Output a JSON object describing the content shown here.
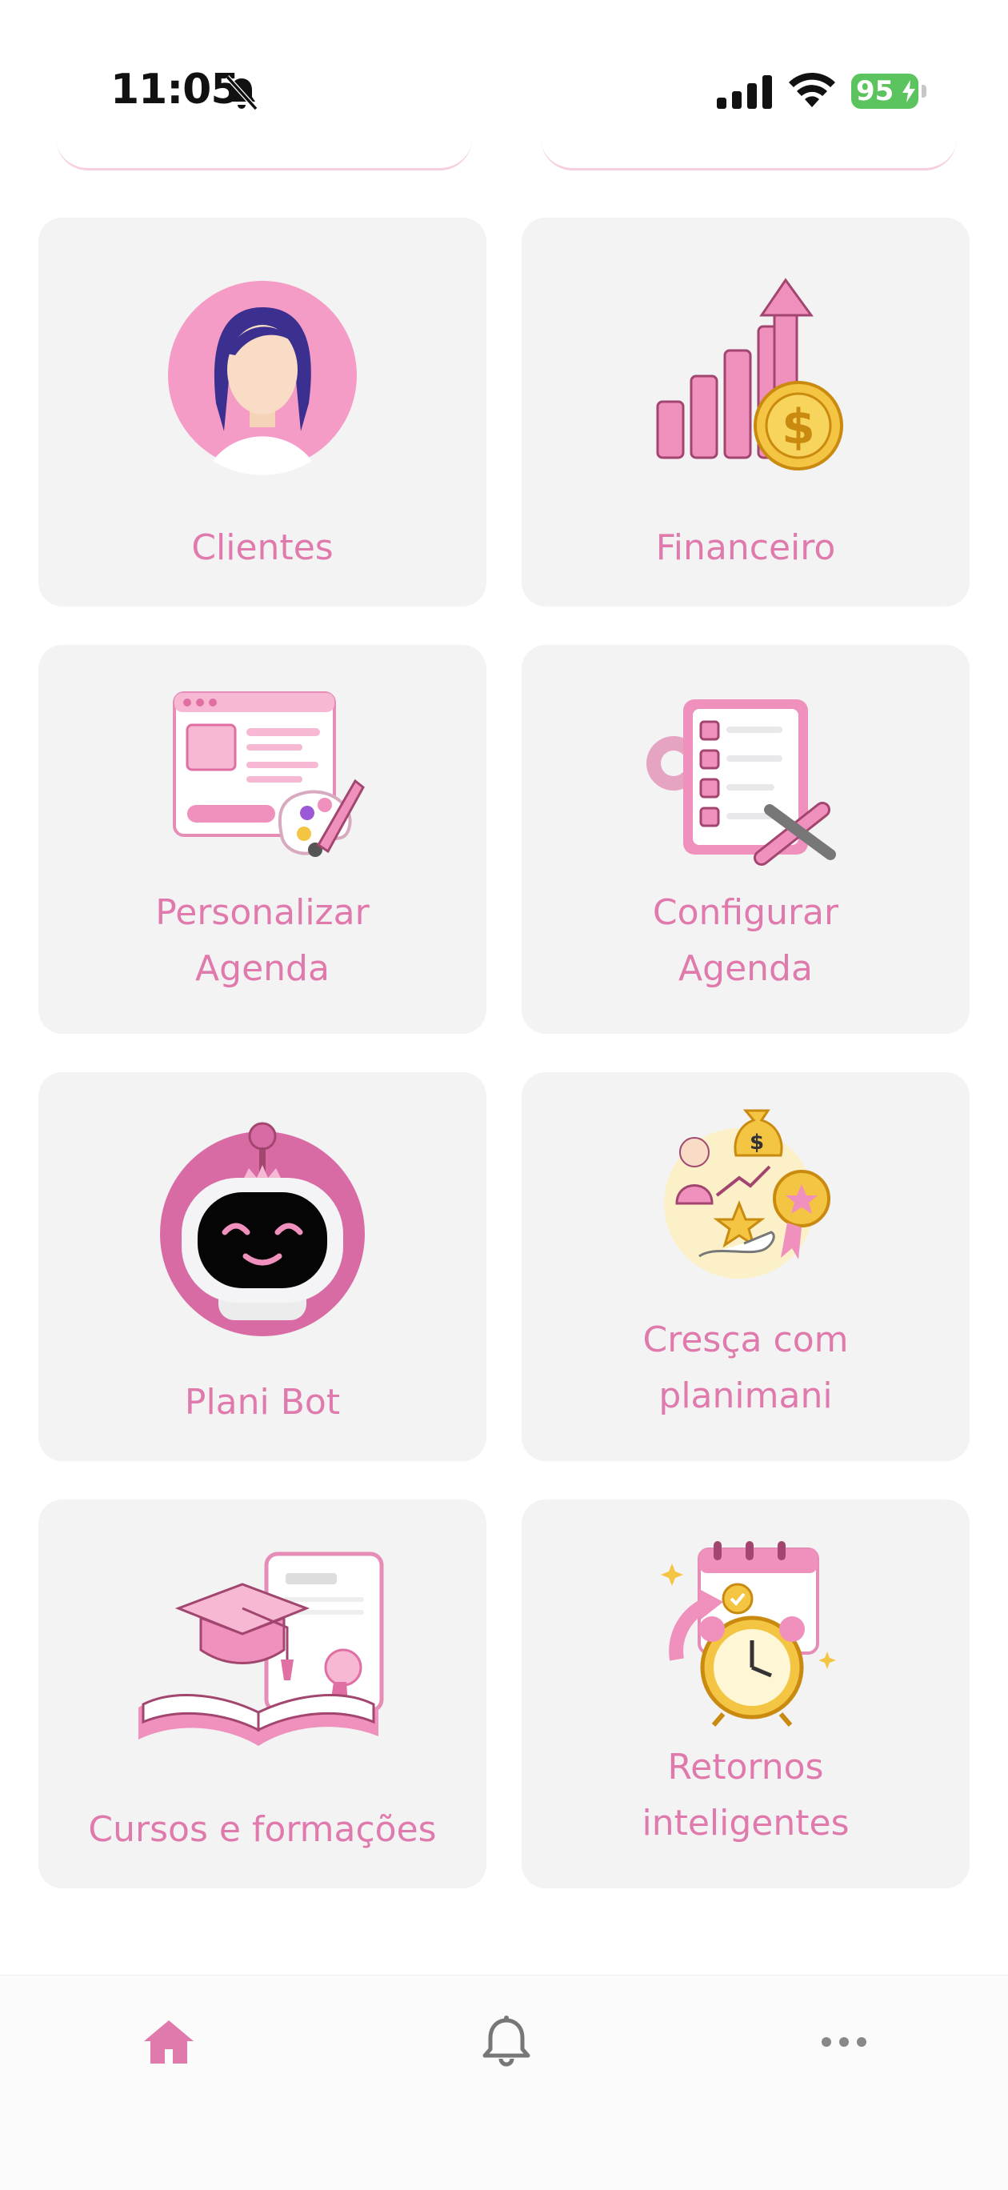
{
  "status_bar": {
    "time": "11:05",
    "battery": "95"
  },
  "colors": {
    "accent": "#e07aac",
    "card_bg": "#f3f3f4",
    "battery_green": "#5cc45f"
  },
  "cards": [
    {
      "label": "Clientes",
      "icon": "client-avatar-icon"
    },
    {
      "label": "Financeiro",
      "icon": "growth-chart-icon"
    },
    {
      "label": "Personalizar\nAgenda",
      "icon": "customize-palette-icon"
    },
    {
      "label": "Configurar\nAgenda",
      "icon": "checklist-settings-icon"
    },
    {
      "label": "Plani Bot",
      "icon": "robot-icon"
    },
    {
      "label": "Cresça com\nplanimani",
      "icon": "grow-rewards-icon"
    },
    {
      "label": "Cursos e formações",
      "icon": "graduation-cap-icon"
    },
    {
      "label": "Retornos\ninteligentes",
      "icon": "alarm-calendar-icon"
    }
  ],
  "tabbar": {
    "items": [
      "home-icon",
      "notifications-icon",
      "more-icon"
    ]
  }
}
